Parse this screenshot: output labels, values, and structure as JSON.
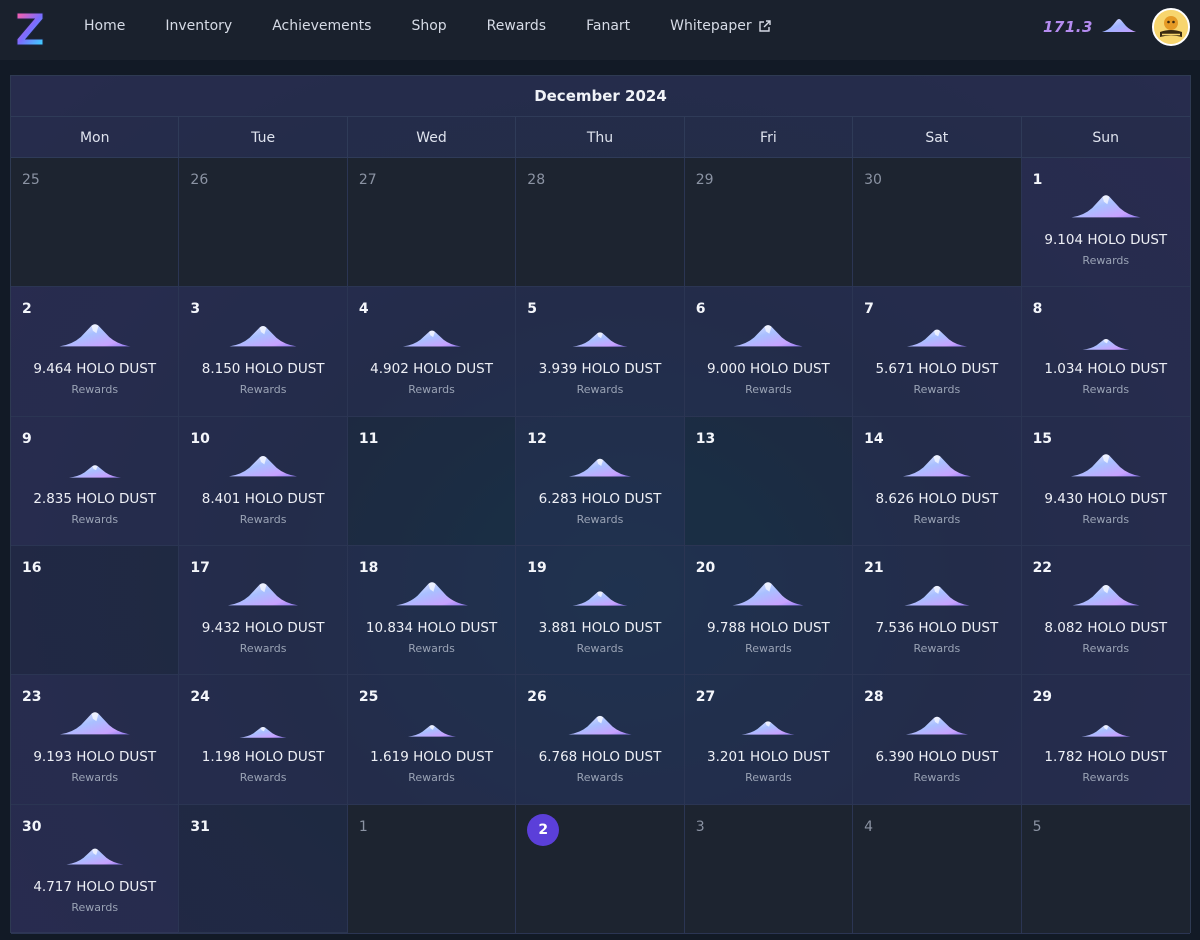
{
  "nav": {
    "logo_icon": "z-logo-icon",
    "links": [
      "Home",
      "Inventory",
      "Achievements",
      "Shop",
      "Rewards",
      "Fanart",
      "Whitepaper"
    ],
    "whitepaper_icon": "external-link-icon",
    "balance": "171.3",
    "balance_icon": "holo-dust-icon",
    "avatar_icon": "humble-avatar-icon"
  },
  "calendar": {
    "title": "December 2024",
    "weekdays": [
      "Mon",
      "Tue",
      "Wed",
      "Thu",
      "Fri",
      "Sat",
      "Sun"
    ],
    "today_label": "2",
    "cells": [
      {
        "day": "25",
        "muted": true
      },
      {
        "day": "26",
        "muted": true
      },
      {
        "day": "27",
        "muted": true
      },
      {
        "day": "28",
        "muted": true
      },
      {
        "day": "29",
        "muted": true
      },
      {
        "day": "30",
        "muted": true
      },
      {
        "day": "1",
        "amount": "9.104 HOLO DUST",
        "sub": "Rewards",
        "size": 0.91
      },
      {
        "day": "2",
        "amount": "9.464 HOLO DUST",
        "sub": "Rewards",
        "size": 0.95
      },
      {
        "day": "3",
        "amount": "8.150 HOLO DUST",
        "sub": "Rewards",
        "size": 0.82
      },
      {
        "day": "4",
        "amount": "4.902 HOLO DUST",
        "sub": "Rewards",
        "size": 0.49
      },
      {
        "day": "5",
        "amount": "3.939 HOLO DUST",
        "sub": "Rewards",
        "size": 0.39
      },
      {
        "day": "6",
        "amount": "9.000 HOLO DUST",
        "sub": "Rewards",
        "size": 0.9
      },
      {
        "day": "7",
        "amount": "5.671 HOLO DUST",
        "sub": "Rewards",
        "size": 0.57
      },
      {
        "day": "8",
        "amount": "1.034 HOLO DUST",
        "sub": "Rewards",
        "size": 0.1
      },
      {
        "day": "9",
        "amount": "2.835 HOLO DUST",
        "sub": "Rewards",
        "size": 0.28
      },
      {
        "day": "10",
        "amount": "8.401 HOLO DUST",
        "sub": "Rewards",
        "size": 0.84
      },
      {
        "day": "11"
      },
      {
        "day": "12",
        "amount": "6.283 HOLO DUST",
        "sub": "Rewards",
        "size": 0.63
      },
      {
        "day": "13"
      },
      {
        "day": "14",
        "amount": "8.626 HOLO DUST",
        "sub": "Rewards",
        "size": 0.86
      },
      {
        "day": "15",
        "amount": "9.430 HOLO DUST",
        "sub": "Rewards",
        "size": 0.94
      },
      {
        "day": "16"
      },
      {
        "day": "17",
        "amount": "9.432 HOLO DUST",
        "sub": "Rewards",
        "size": 0.94
      },
      {
        "day": "18",
        "amount": "10.834 HOLO DUST",
        "sub": "Rewards",
        "size": 1.0
      },
      {
        "day": "19",
        "amount": "3.881 HOLO DUST",
        "sub": "Rewards",
        "size": 0.39
      },
      {
        "day": "20",
        "amount": "9.788 HOLO DUST",
        "sub": "Rewards",
        "size": 0.98
      },
      {
        "day": "21",
        "amount": "7.536 HOLO DUST",
        "sub": "Rewards",
        "size": 0.75
      },
      {
        "day": "22",
        "amount": "8.082 HOLO DUST",
        "sub": "Rewards",
        "size": 0.81
      },
      {
        "day": "23",
        "amount": "9.193 HOLO DUST",
        "sub": "Rewards",
        "size": 0.92
      },
      {
        "day": "24",
        "amount": "1.198 HOLO DUST",
        "sub": "Rewards",
        "size": 0.12
      },
      {
        "day": "25",
        "amount": "1.619 HOLO DUST",
        "sub": "Rewards",
        "size": 0.16
      },
      {
        "day": "26",
        "amount": "6.768 HOLO DUST",
        "sub": "Rewards",
        "size": 0.68
      },
      {
        "day": "27",
        "amount": "3.201 HOLO DUST",
        "sub": "Rewards",
        "size": 0.32
      },
      {
        "day": "28",
        "amount": "6.390 HOLO DUST",
        "sub": "Rewards",
        "size": 0.64
      },
      {
        "day": "29",
        "amount": "1.782 HOLO DUST",
        "sub": "Rewards",
        "size": 0.18
      },
      {
        "day": "30",
        "amount": "4.717 HOLO DUST",
        "sub": "Rewards",
        "size": 0.47
      },
      {
        "day": "31"
      },
      {
        "day": "1",
        "muted": true
      },
      {
        "day": "2",
        "muted": true,
        "today": true
      },
      {
        "day": "3",
        "muted": true
      },
      {
        "day": "4",
        "muted": true
      },
      {
        "day": "5",
        "muted": true
      }
    ]
  }
}
